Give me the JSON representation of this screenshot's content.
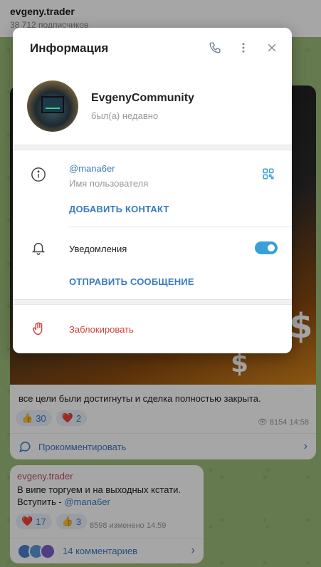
{
  "chat": {
    "title": "evgeny.trader",
    "subscribers": "38 712 подписчиков"
  },
  "post1": {
    "text": "все цели были достигнуты и сделка полностью закрыта.",
    "reactions": [
      {
        "emoji": "👍",
        "count": "30"
      },
      {
        "emoji": "❤️",
        "count": "2"
      }
    ],
    "views": "8154",
    "time": "14:58",
    "comment_label": "Прокомментировать"
  },
  "post2": {
    "author": "evgeny.trader",
    "line1": "В випе торгуем и на выходных кстати.",
    "line2_prefix": "Вступить - ",
    "line2_link": "@mana6er",
    "reactions": [
      {
        "emoji": "❤️",
        "count": "17"
      },
      {
        "emoji": "👍",
        "count": "3"
      }
    ],
    "meta": "8598  изменено 14:59",
    "comments_label": "14 комментариев"
  },
  "dialog": {
    "title": "Информация",
    "profile_name": "EvgenyCommunity",
    "profile_status": "был(а) недавно",
    "username": "@mana6er",
    "username_label": "Имя пользователя",
    "add_contact": "ДОБАВИТЬ КОНТАКТ",
    "notifications_label": "Уведомления",
    "notifications_on": true,
    "send_message": "ОТПРАВИТЬ СООБЩЕНИЕ",
    "block_label": "Заблокировать"
  },
  "colors": {
    "accent": "#3a7bbf",
    "toggle": "#3a9fd8",
    "danger": "#d0443a"
  }
}
